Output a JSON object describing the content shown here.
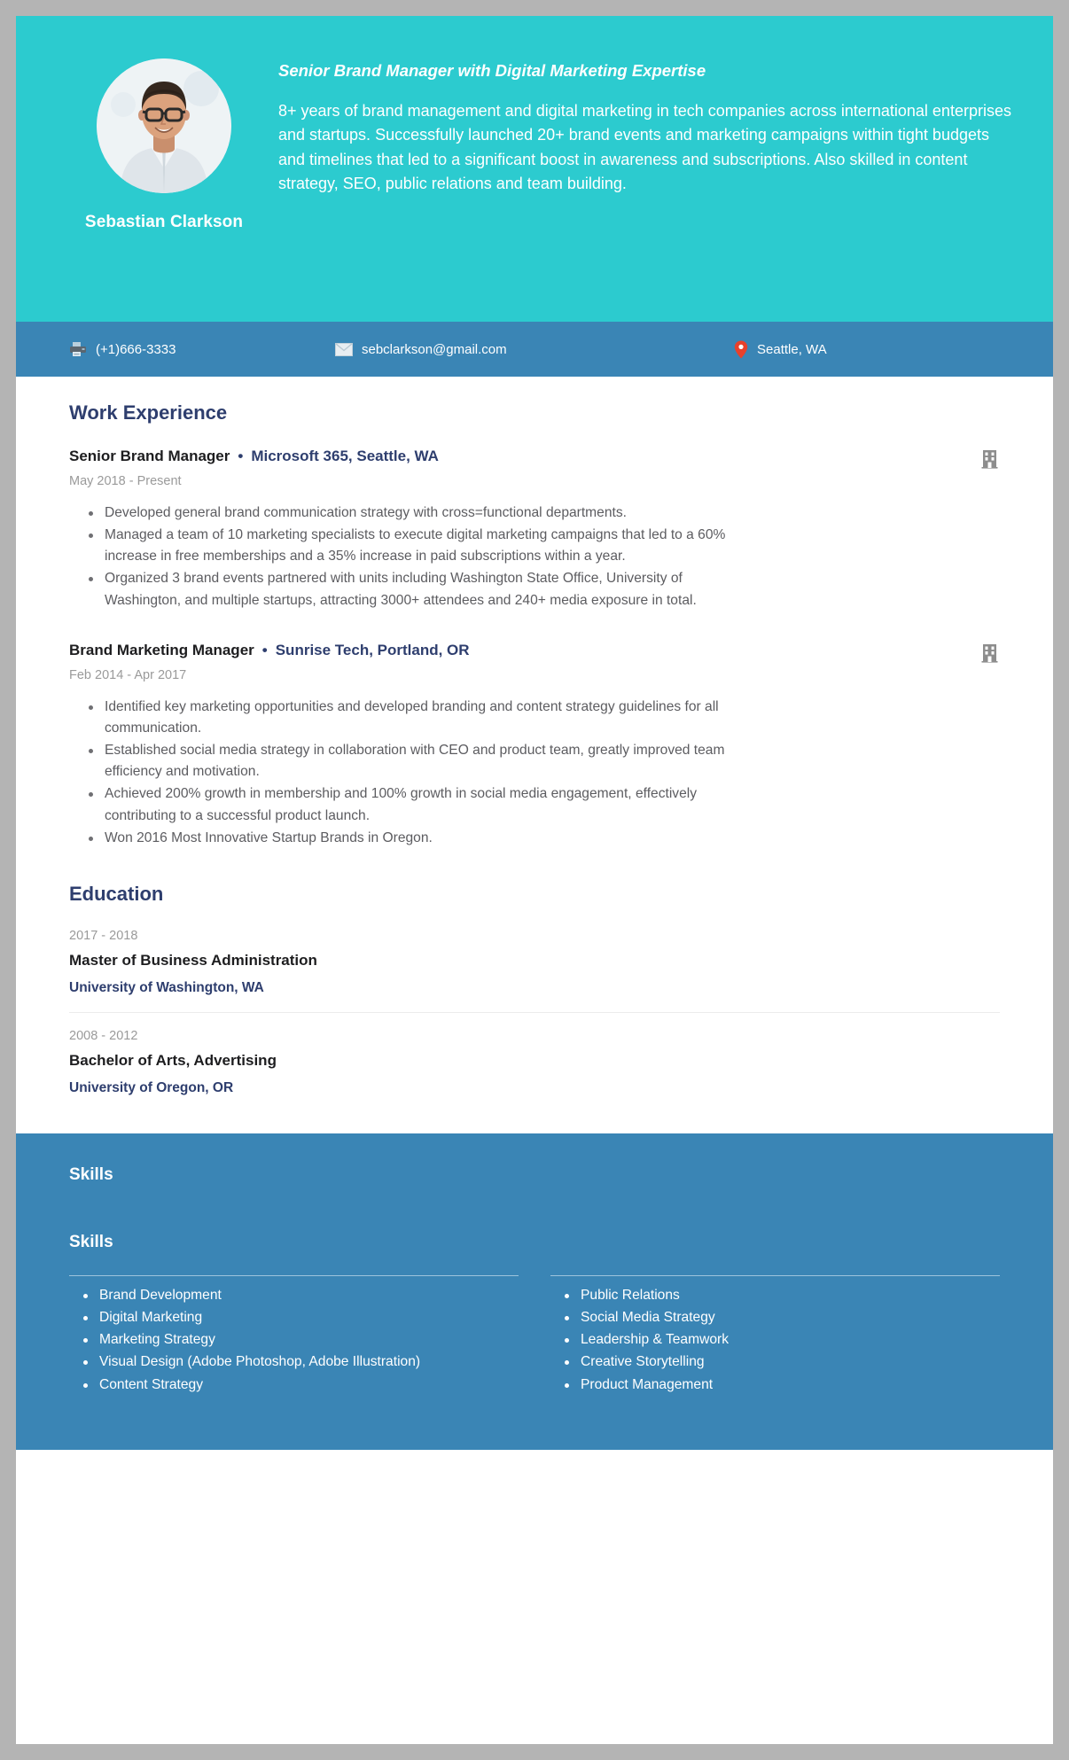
{
  "colors": {
    "teal": "#2ccbcf",
    "blue": "#3a85b5",
    "navy": "#2e3e6e",
    "page_bg": "#b4b4b4",
    "body_text": "#5c5c60",
    "muted": "#9a9a9a",
    "pin_red": "#e8412c"
  },
  "header": {
    "name": "Sebastian Clarkson",
    "headline": "Senior Brand Manager with Digital Marketing Expertise",
    "summary": "8+ years of brand management and digital marketing in tech companies across international enterprises and startups. Successfully launched  20+ brand events and marketing campaigns within tight budgets and timelines that led to a significant boost in awareness and subscriptions. Also skilled in content strategy, SEO, public relations and team building.",
    "avatar_alt": "profile-photo"
  },
  "contact": {
    "phone": {
      "icon": "fax-icon",
      "value": "(+1)666-3333"
    },
    "email": {
      "icon": "envelope-icon",
      "value": "sebclarkson@gmail.com"
    },
    "location": {
      "icon": "map-pin-icon",
      "value": "Seattle, WA"
    }
  },
  "work": {
    "section_title": "Work Experience",
    "jobs": [
      {
        "title": "Senior Brand Manager",
        "separator": "•",
        "company": "Microsoft 365, Seattle, WA",
        "dates": "May  2018 - Present",
        "icon": "office-building-icon",
        "bullets": [
          "Developed general brand communication strategy with cross=functional departments.",
          "Managed a team of 10 marketing specialists to execute digital marketing campaigns that led to a 60% increase in free memberships and a 35% increase in paid subscriptions within a year.",
          "Organized 3 brand events partnered with units including Washington State Office, University of Washington, and multiple startups, attracting 3000+ attendees and 240+ media exposure in total."
        ]
      },
      {
        "title": "Brand Marketing Manager",
        "separator": "•",
        "company": "Sunrise Tech, Portland, OR",
        "dates": "Feb 2014 - Apr 2017",
        "icon": "office-building-icon",
        "bullets": [
          "Identified key marketing opportunities and developed branding and content strategy guidelines for all communication.",
          "Established social media strategy in collaboration with CEO and product team, greatly improved team efficiency and motivation.",
          "Achieved 200% growth in membership and 100% growth in social media engagement, effectively contributing to a successful product launch.",
          "Won 2016 Most Innovative Startup Brands in Oregon."
        ]
      }
    ]
  },
  "education": {
    "section_title": "Education",
    "entries": [
      {
        "years": "2017 - 2018",
        "degree": "Master of Business Administration",
        "school": "University of Washington, WA"
      },
      {
        "years": "2008 - 2012",
        "degree": "Bachelor of Arts, Advertising",
        "school": "University of Oregon, OR"
      }
    ]
  },
  "skills": {
    "block_heading": "Skills",
    "list_heading": "Skills",
    "column_left": [
      "Brand Development",
      "Digital Marketing",
      "Marketing Strategy",
      "Visual Design (Adobe Photoshop, Adobe Illustration)",
      "Content Strategy"
    ],
    "column_right": [
      "Public Relations",
      "Social Media Strategy",
      "Leadership & Teamwork",
      "Creative Storytelling",
      "Product Management"
    ]
  }
}
